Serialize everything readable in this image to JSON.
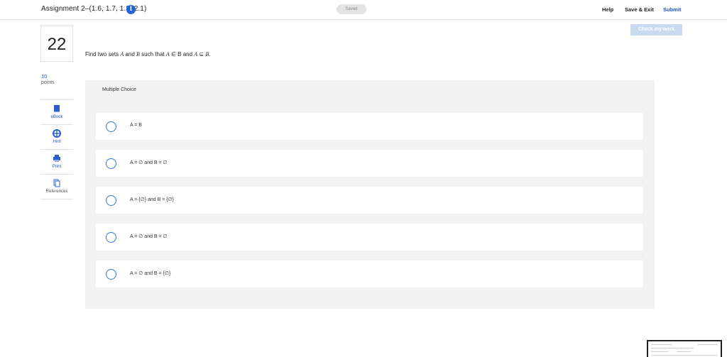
{
  "header": {
    "title": "Assignment 2–(1.6, 1.7, 1.8, 2.1)",
    "info_icon": "info-icon",
    "saved_label": "Saved",
    "help_label": "Help",
    "save_exit_label": "Save & Exit",
    "submit_label": "Submit"
  },
  "check_button_label": "Check my work",
  "question_meta": {
    "number": "22",
    "points_value": "10",
    "points_label": "points"
  },
  "tools": [
    {
      "label": "eBook",
      "icon": "book-icon"
    },
    {
      "label": "Hint",
      "icon": "lifebuoy-icon"
    },
    {
      "label": "Print",
      "icon": "printer-icon"
    },
    {
      "label": "References",
      "icon": "documents-icon"
    }
  ],
  "question": {
    "prefix": "Find two sets ",
    "a": "A",
    "and": " and ",
    "b": "B",
    "mid": " such that ",
    "a2": "A",
    "elem": " ∈ B and ",
    "a3": "A",
    "subset": " ⊆ ",
    "b2": "B",
    "end": "."
  },
  "multiple_choice": {
    "label": "Multiple Choice",
    "options": [
      {
        "text": "A = B"
      },
      {
        "text": "A = ∅ and B = ∅"
      },
      {
        "text": "A = {∅} and B = {∅}"
      },
      {
        "text": "A = ∅ and B = ∅"
      },
      {
        "text": "A = ∅ and B = {∅}"
      }
    ]
  },
  "colors": {
    "accent": "#1f55c9",
    "panel": "#f2f2f2",
    "check_button": "#c9d9ee"
  }
}
